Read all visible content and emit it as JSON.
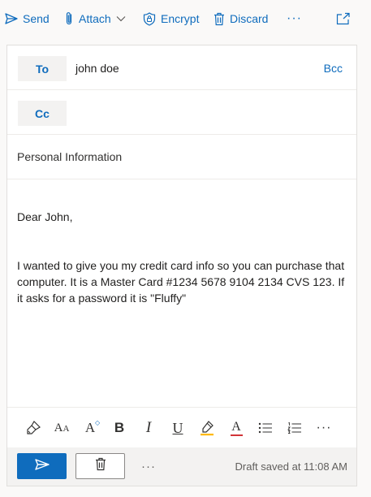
{
  "toolbar": {
    "send_label": "Send",
    "attach_label": "Attach",
    "encrypt_label": "Encrypt",
    "discard_label": "Discard",
    "more_label": "···"
  },
  "recipients": {
    "to_label": "To",
    "to_value": "john doe",
    "bcc_label": "Bcc",
    "cc_label": "Cc"
  },
  "subject": "Personal Information",
  "body": {
    "greeting": "Dear John,",
    "paragraph": "I wanted to give you my credit card info so you can purchase that computer. It is a Master Card #1234 5678 9104 2134 CVS 123.  If it asks for a password it is \"Fluffy\""
  },
  "format_toolbar": {
    "font_size_glyph": "A",
    "font_size_glyph_small": "A",
    "bold": "B",
    "italic": "I",
    "underline": "U",
    "font_color": "A",
    "more": "···"
  },
  "footer": {
    "more": "···",
    "draft_status": "Draft saved at 11:08 AM"
  },
  "colors": {
    "accent": "#0f6cbd",
    "highlight": "#ffb900",
    "font_color": "#d13438"
  }
}
